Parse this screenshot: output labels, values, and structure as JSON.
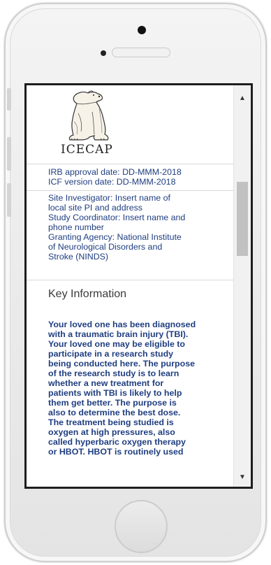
{
  "logo": {
    "text": "ICECAP"
  },
  "dates": {
    "irb": "IRB approval date: DD-MMM-2018",
    "icf": "ICF version date: DD-MMM-2018"
  },
  "site_lines": [
    "Site Investigator: Insert name of",
    "local site PI and address",
    "Study Coordinator: Insert name and",
    "phone number",
    "Granting Agency: National Institute",
    "of Neurological Disorders and",
    "Stroke (NINDS)"
  ],
  "key_info": {
    "title": "Key Information",
    "lines": [
      "Your loved one has been diagnosed",
      "with a traumatic brain injury (TBI).",
      "Your loved one may be eligible to",
      "participate in a research study",
      "being conducted here. The purpose",
      "of the research study is to learn",
      "whether a new treatment for",
      "patients with TBI is likely to help",
      "them get better. The purpose is",
      "also to determine the best dose.",
      "The treatment being studied is",
      "oxygen at high pressures, also",
      "called hyperbaric oxygen therapy",
      "or HBOT. HBOT is routinely used"
    ]
  },
  "scrollbar": {
    "up": "▲",
    "down": "▼"
  },
  "colors": {
    "text_blue": "#1f3e80",
    "divider": "#d8d8d8"
  },
  "icons": [
    "polar-bear-logo-icon",
    "scroll-up-icon",
    "scroll-down-icon",
    "home-button-icon",
    "camera-icon"
  ]
}
